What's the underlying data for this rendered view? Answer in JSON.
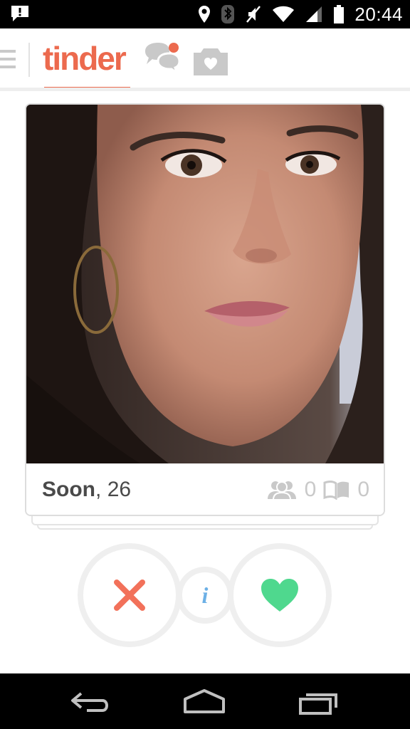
{
  "status_bar": {
    "time": "20:44",
    "icons": [
      "notification-alert-icon",
      "location-icon",
      "bluetooth-icon",
      "mute-icon",
      "wifi-icon",
      "signal-icon",
      "battery-icon"
    ]
  },
  "app_bar": {
    "logo_text": "tinder",
    "accent_color": "#ec6a4e",
    "chat_notification_dot": true,
    "icons": [
      "menu-icon",
      "chat-icon",
      "moments-icon"
    ]
  },
  "card": {
    "name": "Soon",
    "name_separator": ",",
    "age": "26",
    "shared_friends_count": "0",
    "shared_interests_count": "0"
  },
  "actions": {
    "nope_color": "#f2715a",
    "info_label": "i",
    "like_color": "#4fd88e"
  },
  "nav_bar": {
    "icons": [
      "back-icon",
      "home-icon",
      "recents-icon"
    ]
  }
}
